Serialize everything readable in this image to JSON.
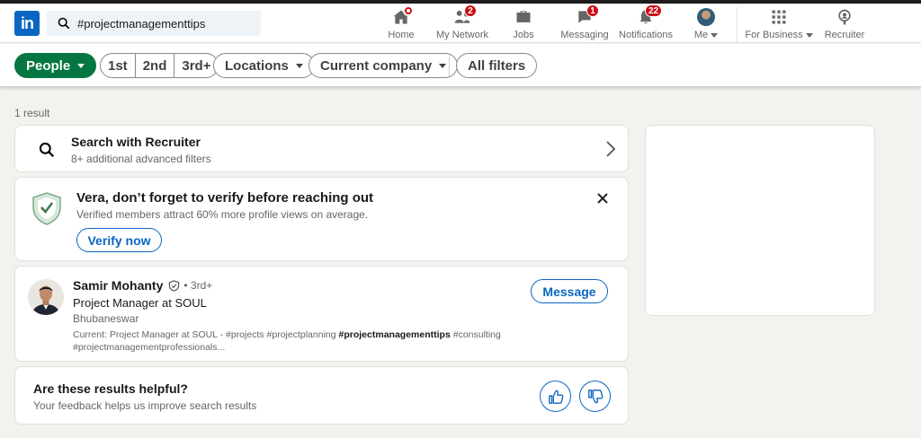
{
  "nav": {
    "search_value": "#projectmanagementtips",
    "items": [
      {
        "label": "Home",
        "icon": "home-icon"
      },
      {
        "label": "My Network",
        "icon": "network-icon",
        "badge": "2"
      },
      {
        "label": "Jobs",
        "icon": "briefcase-icon"
      },
      {
        "label": "Messaging",
        "icon": "messaging-icon",
        "badge": "1"
      },
      {
        "label": "Notifications",
        "icon": "bell-icon",
        "badge": "22"
      },
      {
        "label": "Me",
        "icon": "avatar"
      },
      {
        "label": "For Business",
        "icon": "grid-icon"
      },
      {
        "label": "Recruiter",
        "icon": "recruiter-icon"
      }
    ]
  },
  "filters": {
    "people": "People",
    "connections": [
      "1st",
      "2nd",
      "3rd+"
    ],
    "locations": "Locations",
    "current_company": "Current company",
    "all_filters": "All filters"
  },
  "results": {
    "count": "1 result",
    "recruiter": {
      "title": "Search with Recruiter",
      "subtitle": "8+ additional advanced filters"
    },
    "verify": {
      "title": "Vera, don’t forget to verify before reaching out",
      "subtitle": "Verified members attract 60% more profile views on average.",
      "button": "Verify now"
    },
    "person": {
      "name": "Samir Mohanty",
      "degree": "• 3rd+",
      "headline": "Project Manager at SOUL",
      "location": "Bhubaneswar",
      "summary_prefix": "Current: Project Manager at SOUL - #projects #projectplanning ",
      "summary_highlight": "#projectmanagementtips",
      "summary_suffix": " #consulting #projectmanagementprofessionals...",
      "button": "Message"
    },
    "feedback": {
      "title": "Are these results helpful?",
      "subtitle": "Your feedback helps us improve search results"
    }
  },
  "colors": {
    "brand": "#0a66c2",
    "people_pill": "#057642",
    "badge": "#cc1016"
  }
}
